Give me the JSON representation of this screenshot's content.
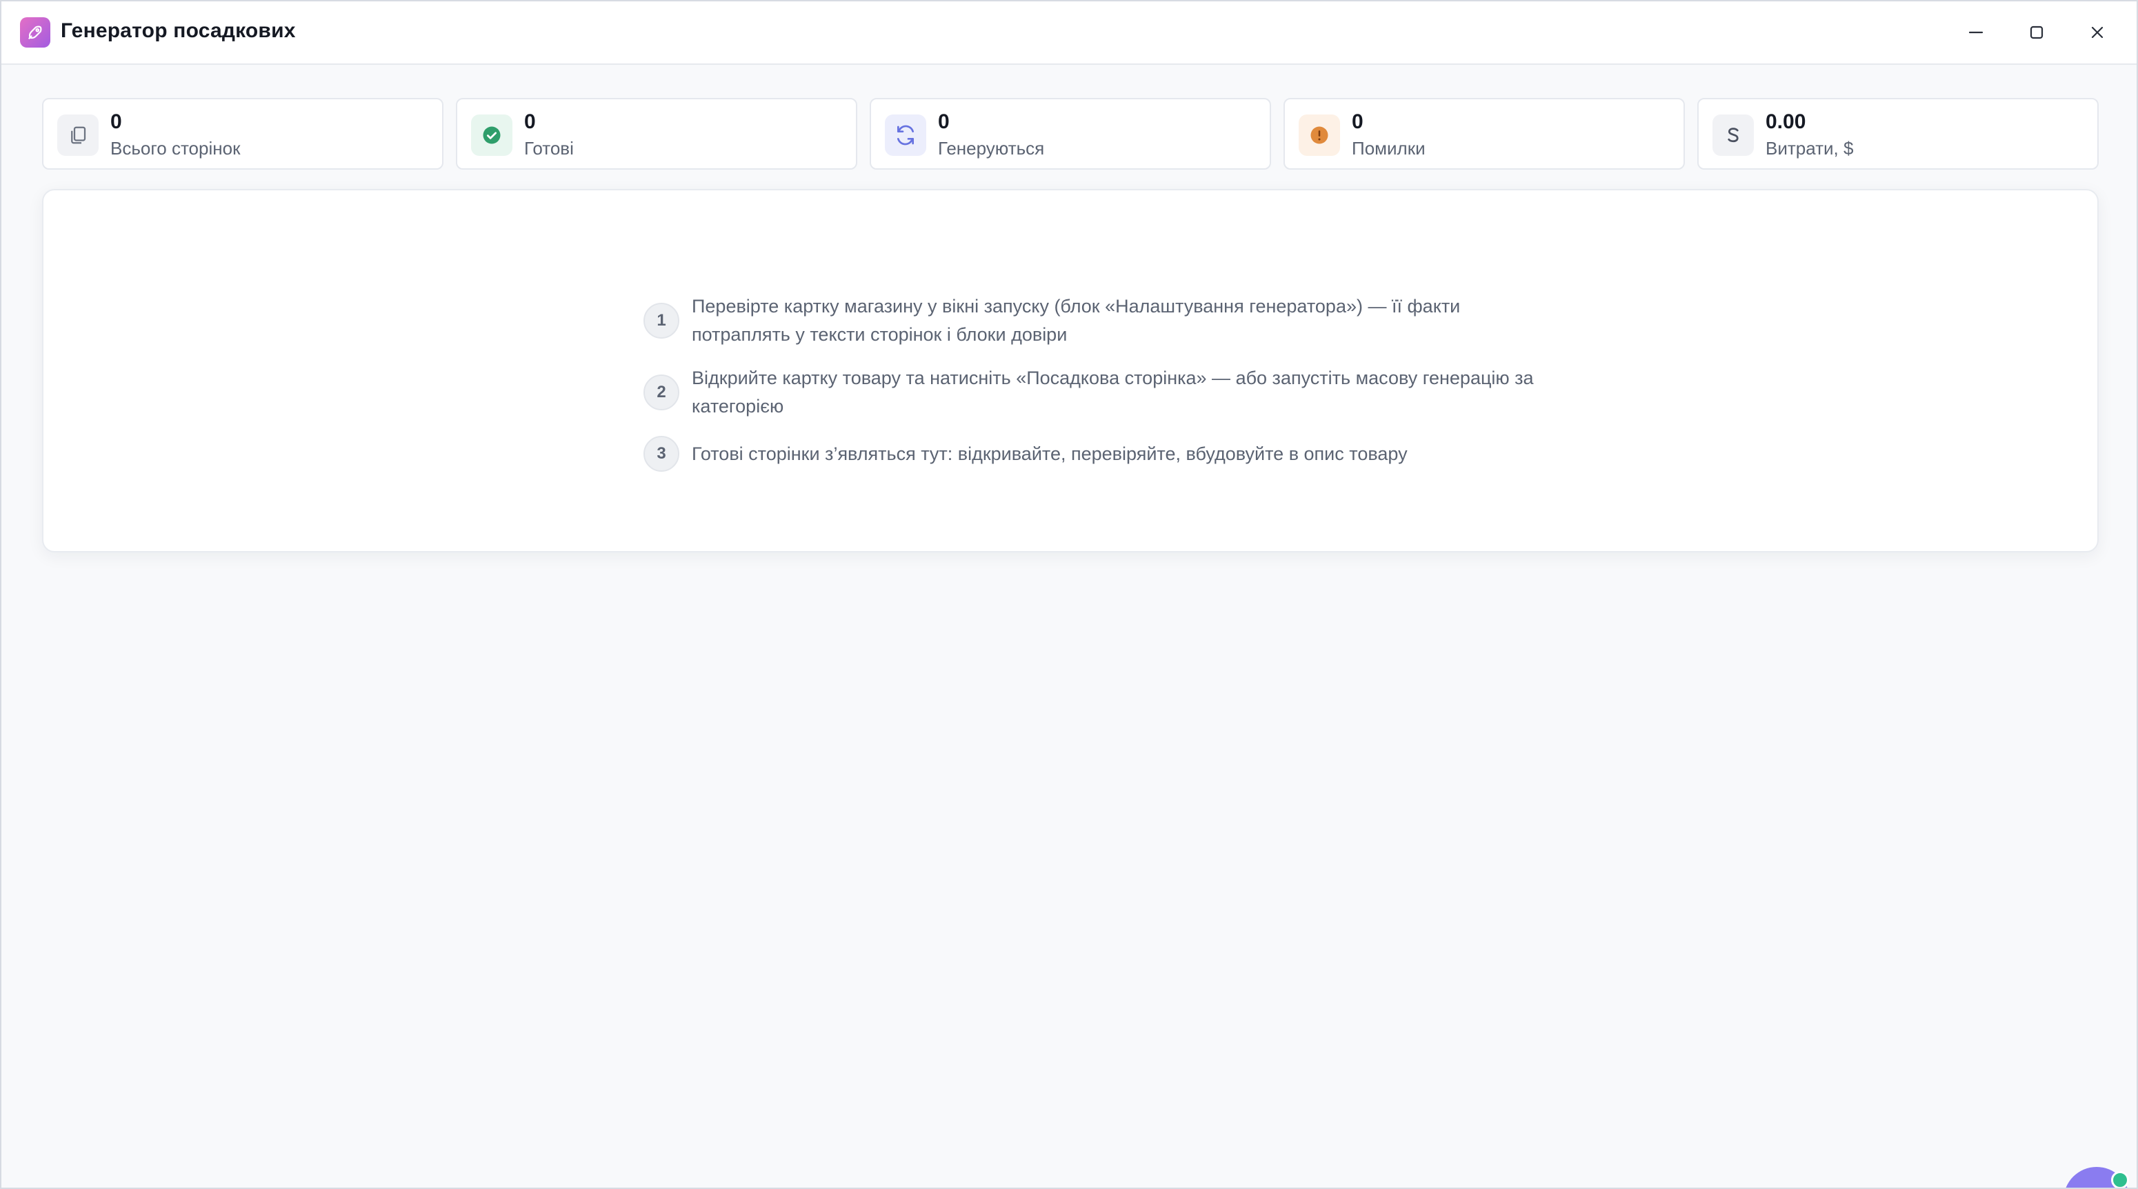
{
  "window": {
    "title": "Генератор посадкових",
    "app_icon": "rocket-icon",
    "controls": [
      "minimize-icon",
      "maximize-icon",
      "close-icon"
    ]
  },
  "stats": [
    {
      "value": "0",
      "label": "Всього сторінок",
      "icon": "copy-icon",
      "color": "#6b7280",
      "bg": "#f1f2f5"
    },
    {
      "value": "0",
      "label": "Готові",
      "icon": "check-circle-icon",
      "color": "#2f9e6b",
      "bg": "#e8f6ef"
    },
    {
      "value": "0",
      "label": "Генеруються",
      "icon": "refresh-icon",
      "color": "#6672e0",
      "bg": "#eceefc"
    },
    {
      "value": "0",
      "label": "Помилки",
      "icon": "alert-circle-icon",
      "color": "#e08a3c",
      "bg": "#fdf1e6"
    },
    {
      "value": "0.00",
      "label": "Витрати, $",
      "icon": "dollar-icon",
      "color": "#4b5160",
      "bg": "#f1f2f5"
    }
  ],
  "steps": [
    {
      "num": "1",
      "text": "Перевірте картку магазину у вікні запуску (блок «Налаштування генератора») — її факти потраплять у тексти сторінок і блоки довіри"
    },
    {
      "num": "2",
      "text": "Відкрийте картку товару та натисніть «Посадкова сторінка» — або запустіть масову генерацію за категорією"
    },
    {
      "num": "3",
      "text": "Готові сторінки з’являться тут: відкривайте, перевіряйте, вбудовуйте в опис товару"
    }
  ],
  "colors": {
    "accent_gradient_start": "#e36fc6",
    "accent_gradient_end": "#a35ce0",
    "status_online": "#2fbf8f",
    "avatar": "#8a7cf0"
  }
}
